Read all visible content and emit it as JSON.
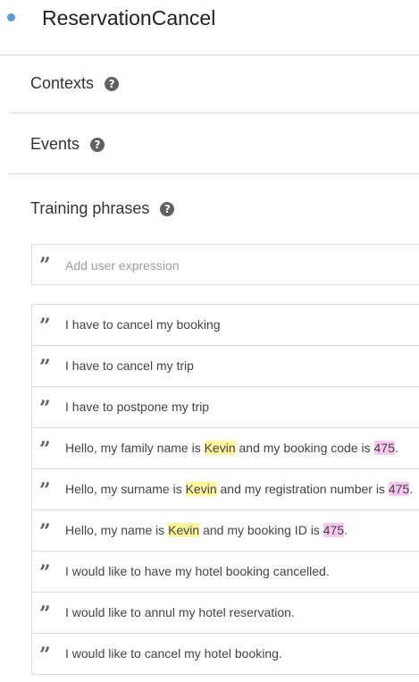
{
  "intent": {
    "name": "ReservationCancel"
  },
  "sections": {
    "contexts": "Contexts",
    "events": "Events",
    "training_phrases": "Training phrases"
  },
  "add_expression": {
    "placeholder": "Add user expression"
  },
  "phrases": [
    {
      "segments": [
        {
          "text": "I have to cancel my booking"
        }
      ]
    },
    {
      "segments": [
        {
          "text": "I have to cancel my trip"
        }
      ]
    },
    {
      "segments": [
        {
          "text": "I have to postpone my trip"
        }
      ]
    },
    {
      "segments": [
        {
          "text": "Hello, my family name is "
        },
        {
          "text": "Kevin",
          "highlight": "#fff59d"
        },
        {
          "text": " and my booking code is "
        },
        {
          "text": "475",
          "highlight": "#f8c8f0"
        },
        {
          "text": "."
        }
      ]
    },
    {
      "segments": [
        {
          "text": "Hello, my surname is "
        },
        {
          "text": "Kevin",
          "highlight": "#fff59d"
        },
        {
          "text": " and my registration number is "
        },
        {
          "text": "475",
          "highlight": "#f8c8f0"
        },
        {
          "text": "."
        }
      ]
    },
    {
      "segments": [
        {
          "text": "Hello, my name is "
        },
        {
          "text": "Kevin",
          "highlight": "#fff59d"
        },
        {
          "text": " and my booking ID is "
        },
        {
          "text": "475",
          "highlight": "#f8c8f0"
        },
        {
          "text": "."
        }
      ]
    },
    {
      "segments": [
        {
          "text": "I would like to have my hotel booking cancelled."
        }
      ]
    },
    {
      "segments": [
        {
          "text": "I would like to annul my hotel reservation."
        }
      ]
    },
    {
      "segments": [
        {
          "text": "I would like to cancel my hotel booking."
        }
      ]
    }
  ],
  "colors": {
    "status_dot": "#5b9bd5",
    "entity_name": "#fff59d",
    "entity_number": "#f8c8f0"
  },
  "icons": {
    "quote": "quote-icon",
    "help": "help-icon",
    "status": "status-dot-icon"
  }
}
